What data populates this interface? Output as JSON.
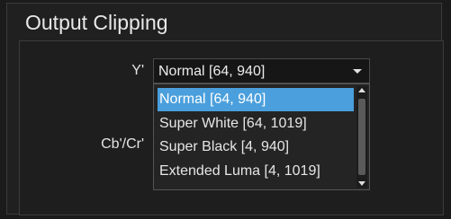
{
  "panel": {
    "title": "Output Clipping"
  },
  "fields": {
    "y_label": "Y'",
    "cbcr_label": "Cb'/Cr'"
  },
  "y_select": {
    "value": "Normal [64, 940]",
    "icon": "chevron-down-icon",
    "options": [
      "Normal [64, 940]",
      "Super White [64, 1019]",
      "Super Black [4, 940]",
      "Extended Luma [4, 1019]"
    ],
    "selected_index": 0
  },
  "colors": {
    "accent": "#4a9fdc",
    "background": "#1b1b1b",
    "text": "#e6e6e6"
  }
}
